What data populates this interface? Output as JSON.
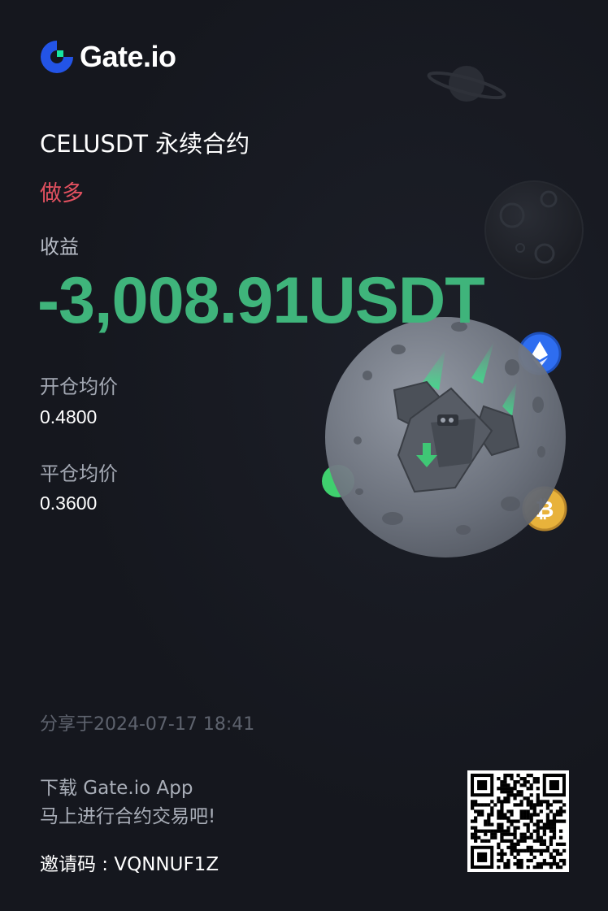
{
  "brand": {
    "name": "Gate.io",
    "accent": "#2354e6",
    "accent_green": "#17e6a1"
  },
  "contract": {
    "title": "CELUSDT 永续合约",
    "side": "做多",
    "side_color": "#e0505f"
  },
  "profit": {
    "label": "收益",
    "value": "-3,008.91USDT",
    "color": "#3fb47b"
  },
  "entry_price": {
    "label": "开仓均价",
    "value": "0.4800"
  },
  "exit_price": {
    "label": "平仓均价",
    "value": "0.3600"
  },
  "footer": {
    "share_time": "分享于2024-07-17 18:41",
    "download_line1": "下载 Gate.io App",
    "download_line2": "马上进行合约交易吧!",
    "invite": "邀请码 : VQNNUF1Z"
  },
  "icons": [
    "gateio-logo-icon",
    "planet-icon",
    "moon-icon",
    "spaceship-icon",
    "ethereum-coin-icon",
    "bitcoin-coin-icon",
    "qr-code-icon"
  ]
}
